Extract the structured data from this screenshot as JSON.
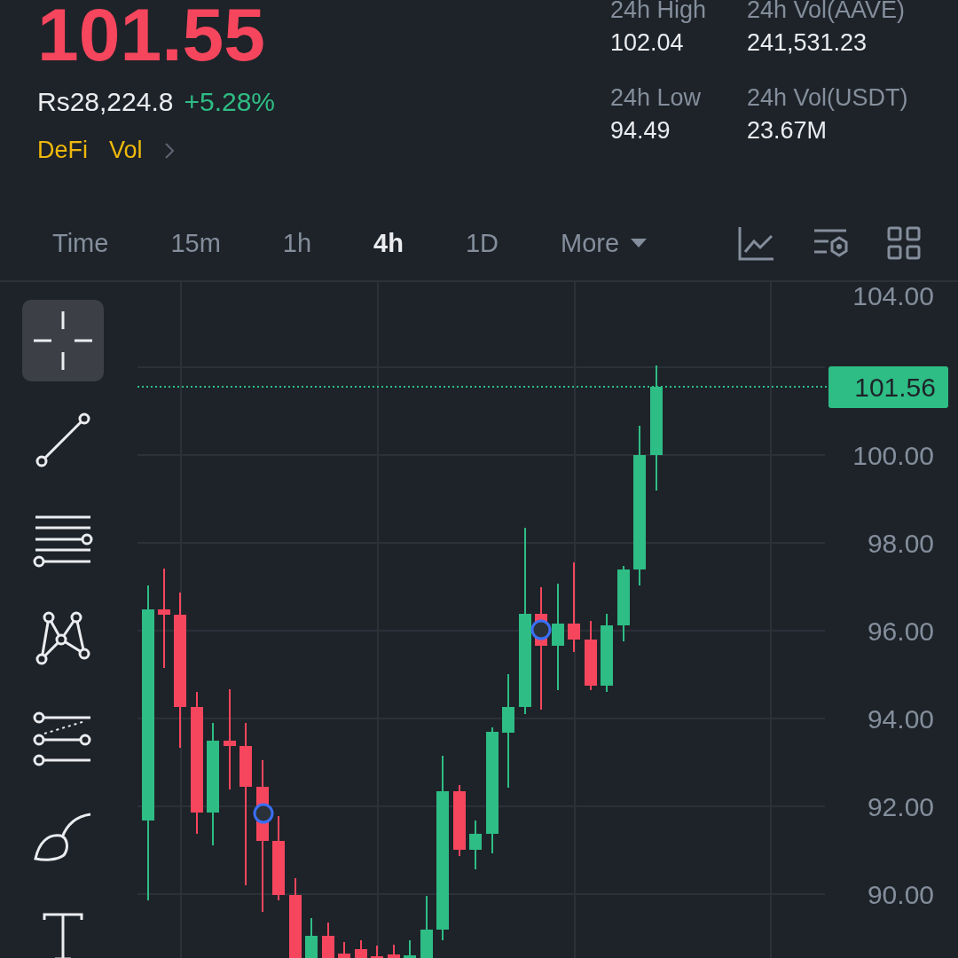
{
  "header": {
    "last_price": "101.55",
    "fiat_price": "Rs28,224.8",
    "change": "+5.28%",
    "tags": [
      "DeFi",
      "Vol"
    ]
  },
  "stats": [
    {
      "label": "24h High",
      "value": "102.04"
    },
    {
      "label": "24h Vol(AAVE)",
      "value": "241,531.23"
    },
    {
      "label": "24h Low",
      "value": "94.49"
    },
    {
      "label": "24h Vol(USDT)",
      "value": "23.67M"
    }
  ],
  "intervals": [
    {
      "label": "Time",
      "kind": "interval",
      "selected": false
    },
    {
      "label": "15m",
      "kind": "interval",
      "selected": false
    },
    {
      "label": "1h",
      "kind": "interval",
      "selected": false
    },
    {
      "label": "4h",
      "kind": "interval",
      "selected": true
    },
    {
      "label": "1D",
      "kind": "interval",
      "selected": false
    },
    {
      "label": "More",
      "kind": "dropdown",
      "selected": false
    }
  ],
  "chart": {
    "price_axis": [
      "104.00",
      "100.00",
      "98.00",
      "96.00",
      "94.00",
      "92.00",
      "90.00"
    ],
    "current_price": "101.56",
    "tools": [
      {
        "kind": "crosshair",
        "selected": true
      },
      {
        "kind": "trend-line",
        "selected": false
      },
      {
        "kind": "horizontal-lines",
        "selected": false
      },
      {
        "kind": "pattern",
        "selected": false
      },
      {
        "kind": "channel",
        "selected": false
      },
      {
        "kind": "brush",
        "selected": false
      },
      {
        "kind": "text",
        "selected": false
      }
    ]
  }
}
